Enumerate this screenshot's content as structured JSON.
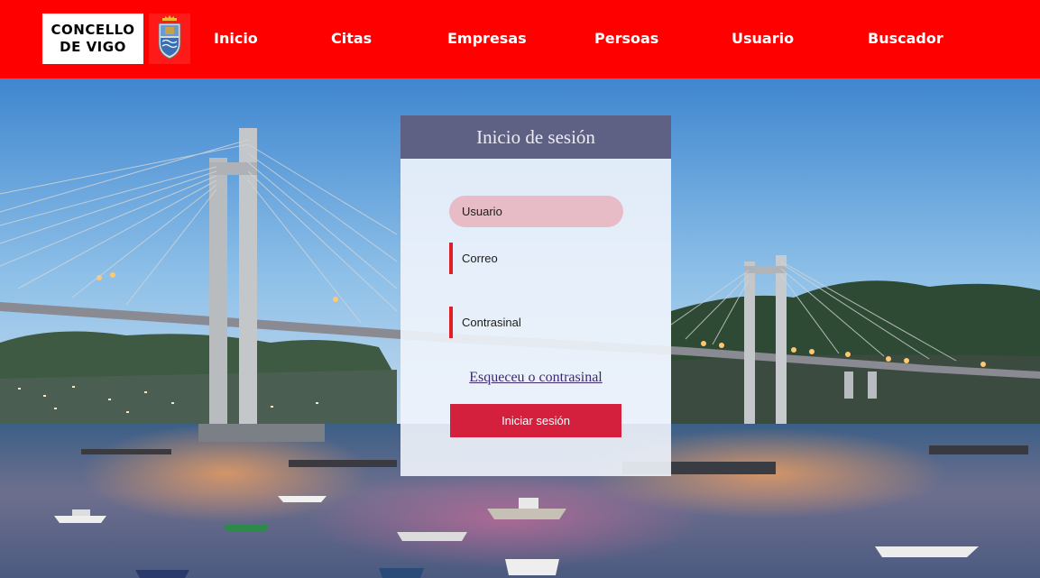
{
  "header": {
    "logo_line1": "CONCELLO",
    "logo_line2": "DE VIGO",
    "nav": [
      {
        "label": "Inicio"
      },
      {
        "label": "Citas"
      },
      {
        "label": "Empresas"
      },
      {
        "label": "Persoas"
      },
      {
        "label": "Usuario"
      },
      {
        "label": "Buscador"
      }
    ]
  },
  "login": {
    "title": "Inicio de sesión",
    "username_placeholder": "Usuario",
    "email_placeholder": "Correo",
    "password_placeholder": "Contrasinal",
    "forgot_link": "Esqueceu o contrasinal",
    "submit_label": "Iniciar sesión"
  },
  "colors": {
    "header_bg": "#ff0000",
    "card_header_bg": "#5f6184",
    "button_bg": "#d41f3d",
    "active_field_bg": "#e7bcc6",
    "field_marker": "#e01f26"
  }
}
